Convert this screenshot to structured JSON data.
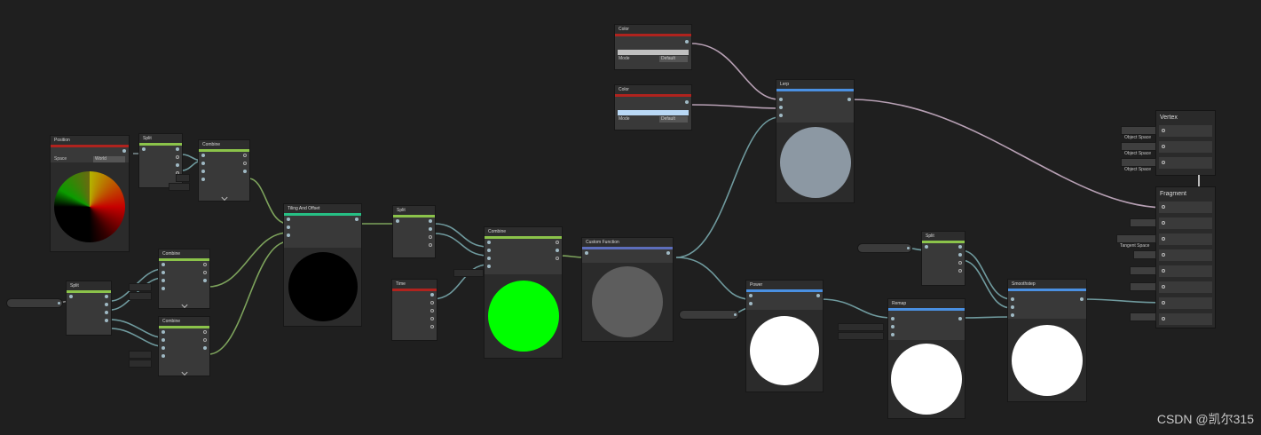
{
  "watermark": "CSDN @凯尔315",
  "nodes": {
    "position": {
      "title": "Position",
      "space_label": "Space",
      "space_value": "World"
    },
    "split_1": {
      "title": "Split"
    },
    "combine_1": {
      "title": "Combine"
    },
    "split_uv": {
      "title": "Split"
    },
    "combine_2": {
      "title": "Combine"
    },
    "combine_3": {
      "title": "Combine"
    },
    "tiling": {
      "title": "Tiling And Offset"
    },
    "split_2": {
      "title": "Split"
    },
    "time": {
      "title": "Time"
    },
    "combine_4": {
      "title": "Combine"
    },
    "custom_function": {
      "title": "Custom Function"
    },
    "color_1": {
      "title": "Color",
      "mode_label": "Mode",
      "mode_value": "Default"
    },
    "color_2": {
      "title": "Color",
      "mode_label": "Mode",
      "mode_value": "Default"
    },
    "lerp": {
      "title": "Lerp"
    },
    "power": {
      "title": "Power"
    },
    "remap": {
      "title": "Remap"
    },
    "split_3": {
      "title": "Split"
    },
    "smoothstep": {
      "title": "Smoothstep"
    }
  },
  "master": {
    "vertex_title": "Vertex",
    "fragment_title": "Fragment",
    "vertex_spaces": [
      "Object Space",
      "Object Space",
      "Object Space"
    ],
    "fragment_controls": [
      "",
      "",
      "Tangent Space",
      "",
      "",
      "",
      "",
      ""
    ]
  },
  "colors": {
    "background": "#1f1f1f",
    "node": "#393939",
    "bar_red": "#b0231e",
    "bar_green": "#8bc34a",
    "bar_teal": "#26c085",
    "bar_blue": "#4a90e2",
    "wire": "#6f9a9e",
    "wire_green": "#7da35c",
    "wire_pink": "#b7a0b4",
    "preview_green": "#00ff00",
    "preview_grey": "#5d5d5d",
    "preview_lerp": "#8c98a3",
    "color_swatch_1": "#c0c0c0",
    "color_swatch_2": "#b9d8f5"
  }
}
